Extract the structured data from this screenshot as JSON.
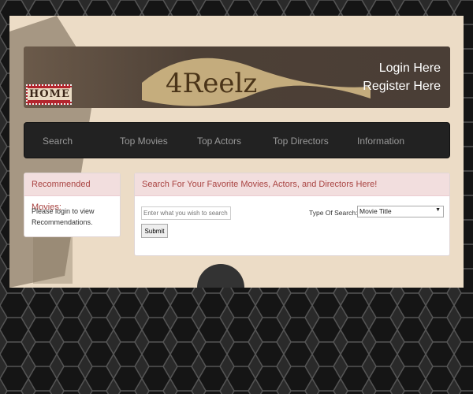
{
  "banner": {
    "home_label": "HOME",
    "logo_text": "4Reelz",
    "login": "Login Here",
    "register": "Register Here"
  },
  "nav": {
    "items": [
      "Search",
      "Top Movies",
      "Top Actors",
      "Top Directors",
      "Information"
    ]
  },
  "recommended": {
    "title": "Recommended Movies:",
    "message": "Please login to view Recommendations."
  },
  "search": {
    "title": "Search For Your Favorite Movies, Actors, and Directors Here!",
    "placeholder": "Enter what you wish to search",
    "submit": "Submit",
    "type_label": "Type Of Search:",
    "type_value": "Movie Title"
  }
}
